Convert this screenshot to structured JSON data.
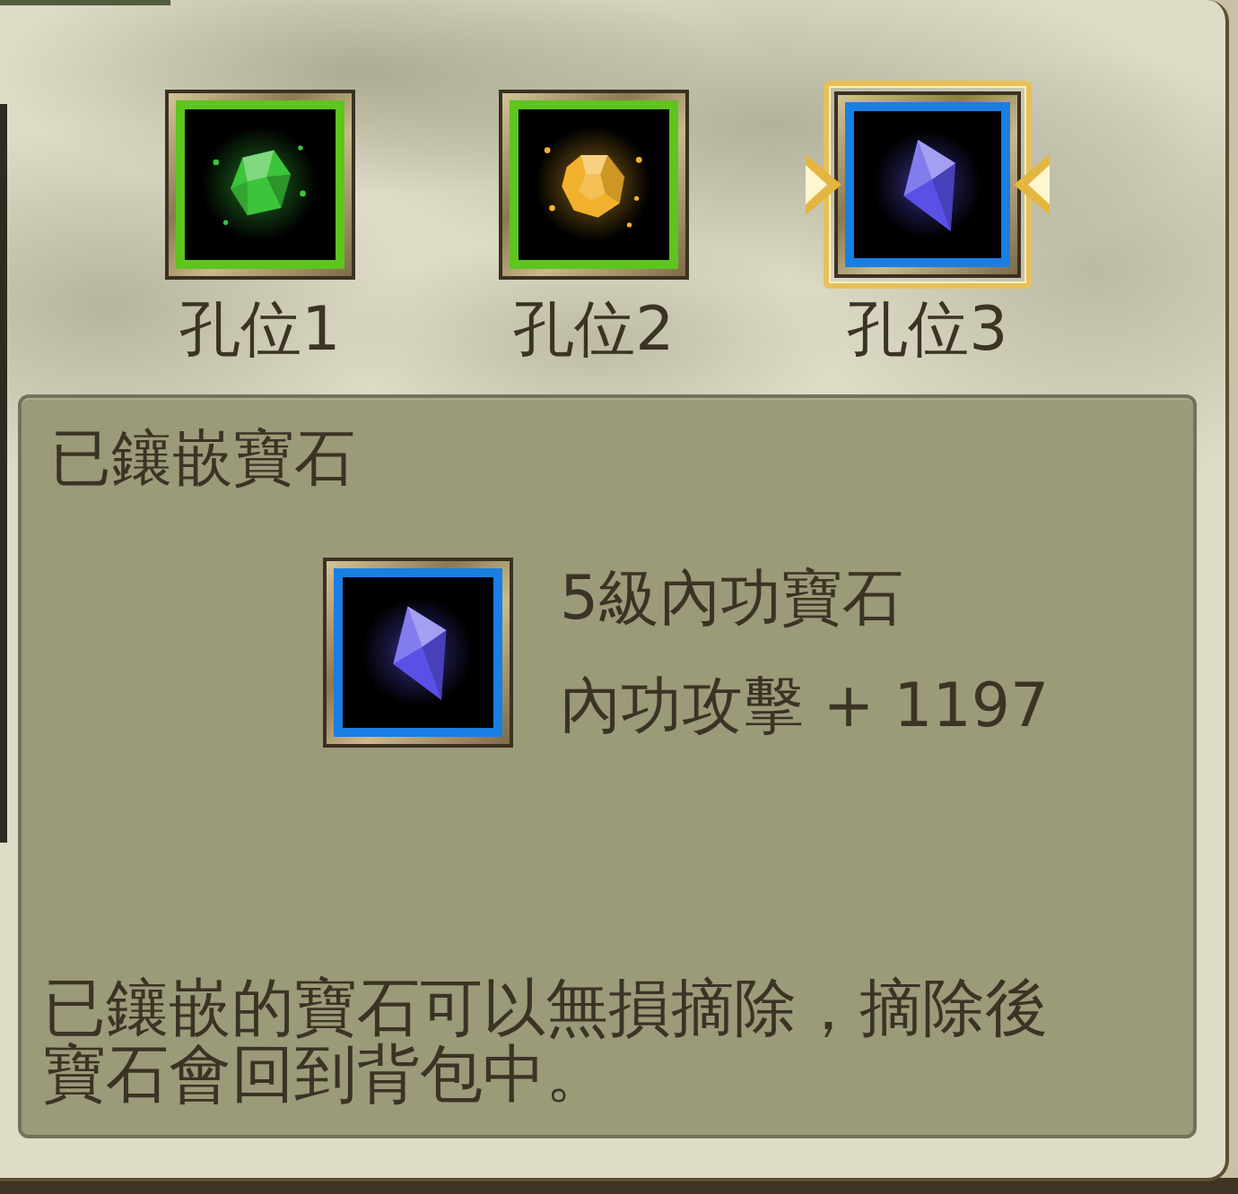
{
  "sockets": [
    {
      "label": "孔位1",
      "selected": false,
      "frame": {
        "color": "#5ec41e"
      },
      "gem": {
        "kind": "rough",
        "color": "#3cc43a"
      }
    },
    {
      "label": "孔位2",
      "selected": false,
      "frame": {
        "color": "#5ec41e"
      },
      "gem": {
        "kind": "round",
        "color": "#f2b12c"
      }
    },
    {
      "label": "孔位3",
      "selected": true,
      "frame": {
        "color": "#1a7ee2"
      },
      "gem": {
        "kind": "shard",
        "color": "#5a50e6"
      }
    }
  ],
  "panel": {
    "title": "已鑲嵌寶石",
    "frame": {
      "color": "#1a7ee2"
    },
    "gem": {
      "kind": "shard",
      "color": "#5a50e6"
    },
    "name": "5級內功寶石",
    "stat": "內功攻擊 + 1197",
    "note": "已鑲嵌的寶石可以無損摘除，摘除後寶石會回到背包中。"
  }
}
